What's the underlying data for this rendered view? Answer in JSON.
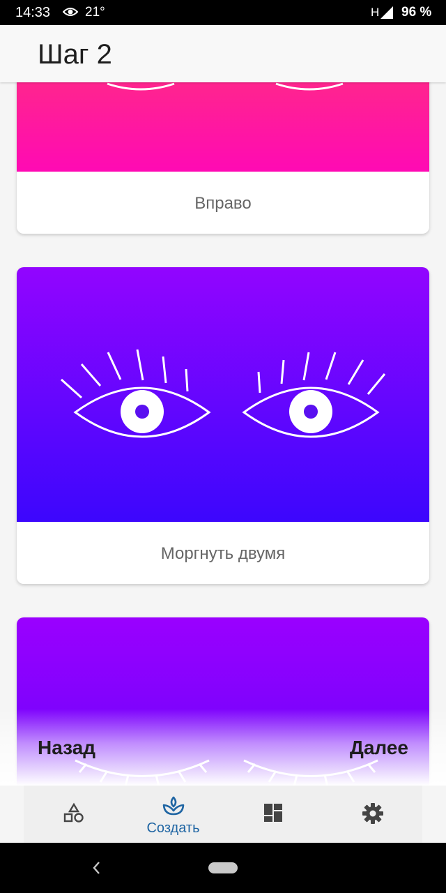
{
  "status_bar": {
    "time": "14:33",
    "temperature": "21°",
    "network": "H",
    "battery": "96 %",
    "icons": [
      "eye-icon",
      "signal-icon"
    ]
  },
  "header": {
    "title": "Шаг 2"
  },
  "cards": [
    {
      "label": "Вправо",
      "color_top": "#ff3d6b",
      "color_bottom": "#ff0ab4"
    },
    {
      "label": "Моргнуть двумя",
      "color_top": "#9205ff",
      "color_bottom": "#3c06fd"
    },
    {
      "label": "",
      "color_top": "#9a00ff",
      "color_bottom": "#5d05fa"
    }
  ],
  "actions": {
    "back": "Назад",
    "next": "Далее"
  },
  "bottom_nav": {
    "tabs": [
      {
        "icon": "shapes-icon",
        "label": ""
      },
      {
        "icon": "sprout-icon",
        "label": "Создать",
        "active": true
      },
      {
        "icon": "dashboard-icon",
        "label": ""
      },
      {
        "icon": "gear-icon",
        "label": ""
      }
    ],
    "active_color": "#1f65a3"
  },
  "system_nav": {
    "icons": [
      "back-chevron-icon",
      "home-pill-icon"
    ]
  }
}
